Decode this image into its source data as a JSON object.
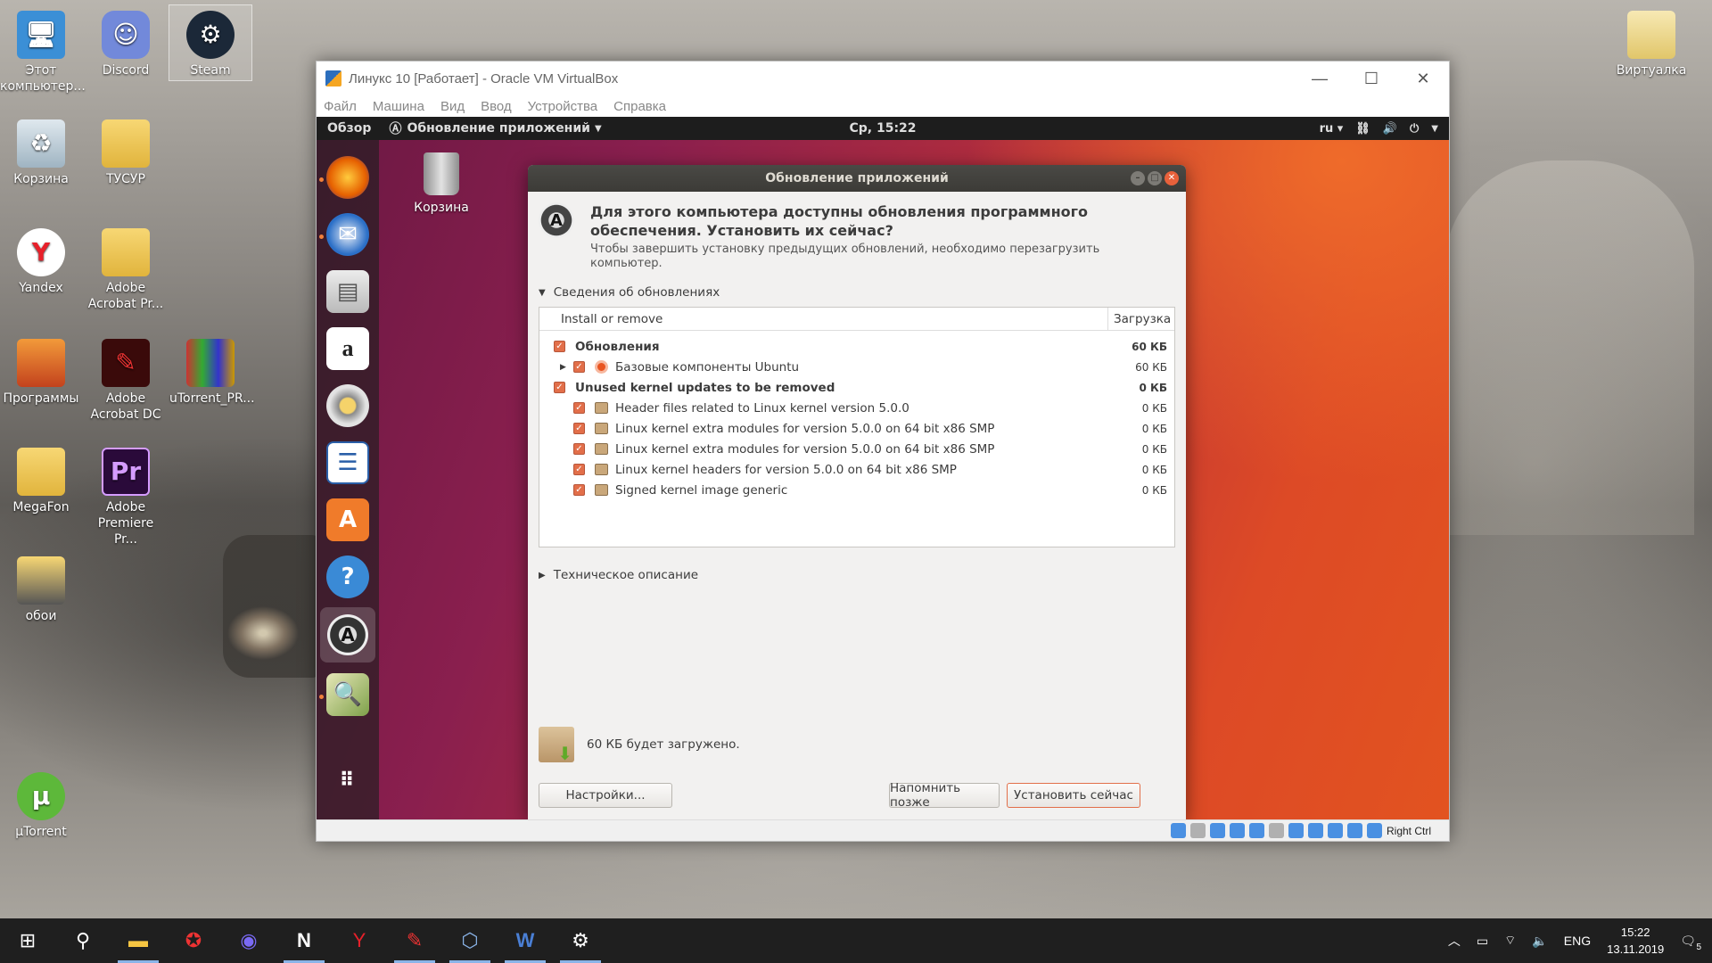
{
  "desktop": {
    "icons": [
      {
        "label": "Этот компьютер..."
      },
      {
        "label": "Discord"
      },
      {
        "label": "Steam"
      },
      {
        "label": "Корзина"
      },
      {
        "label": "ТУСУР"
      },
      {
        "label": "Yandex"
      },
      {
        "label": "Adobe Acrobat Pr..."
      },
      {
        "label": "Программы"
      },
      {
        "label": "Adobe Acrobat DC"
      },
      {
        "label": "uTorrent_PR..."
      },
      {
        "label": "MegaFon"
      },
      {
        "label": "Adobe Premiere Pr..."
      },
      {
        "label": "обои"
      },
      {
        "label": "µTorrent"
      },
      {
        "label": "Виртуалка"
      }
    ]
  },
  "vbox": {
    "title": "Линукс 10 [Работает] - Oracle VM VirtualBox",
    "menu": [
      "Файл",
      "Машина",
      "Вид",
      "Ввод",
      "Устройства",
      "Справка"
    ],
    "status_host_key": "Right Ctrl"
  },
  "ubuntu": {
    "topbar": {
      "overview": "Обзор",
      "app_menu": "Обновление приложений",
      "clock": "Ср, 15:22",
      "lang": "ru"
    },
    "desktop_trash": "Корзина",
    "dialog": {
      "title": "Обновление приложений",
      "heading": "Для этого компьютера доступны обновления программного обеспечения. Установить их сейчас?",
      "subtext": "Чтобы завершить установку предыдущих обновлений, необходимо перезагрузить компьютер.",
      "details_expander": "Сведения об обновлениях",
      "columns": {
        "name": "Install or remove",
        "size": "Загрузка"
      },
      "rows": [
        {
          "label": "Обновления",
          "size": "60 КБ"
        },
        {
          "label": "Базовые компоненты Ubuntu",
          "size": "60 КБ"
        },
        {
          "label": "Unused kernel updates to be removed",
          "size": "0 КБ"
        },
        {
          "label": "Header files related to Linux kernel version 5.0.0",
          "size": "0 КБ"
        },
        {
          "label": "Linux kernel extra modules for version 5.0.0 on 64 bit x86 SMP",
          "size": "0 КБ"
        },
        {
          "label": "Linux kernel extra modules for version 5.0.0 on 64 bit x86 SMP",
          "size": "0 КБ"
        },
        {
          "label": "Linux kernel headers for version 5.0.0 on 64 bit x86 SMP",
          "size": "0 КБ"
        },
        {
          "label": "Signed kernel image generic",
          "size": "0 КБ"
        }
      ],
      "tech_expander": "Техническое описание",
      "download_summary": "60 КБ будет загружено.",
      "settings_button": "Настройки...",
      "remind_button": "Напомнить позже",
      "install_button": "Установить сейчас"
    }
  },
  "taskbar": {
    "lang": "ENG",
    "time": "15:22",
    "date": "13.11.2019",
    "notif_count": "5"
  }
}
